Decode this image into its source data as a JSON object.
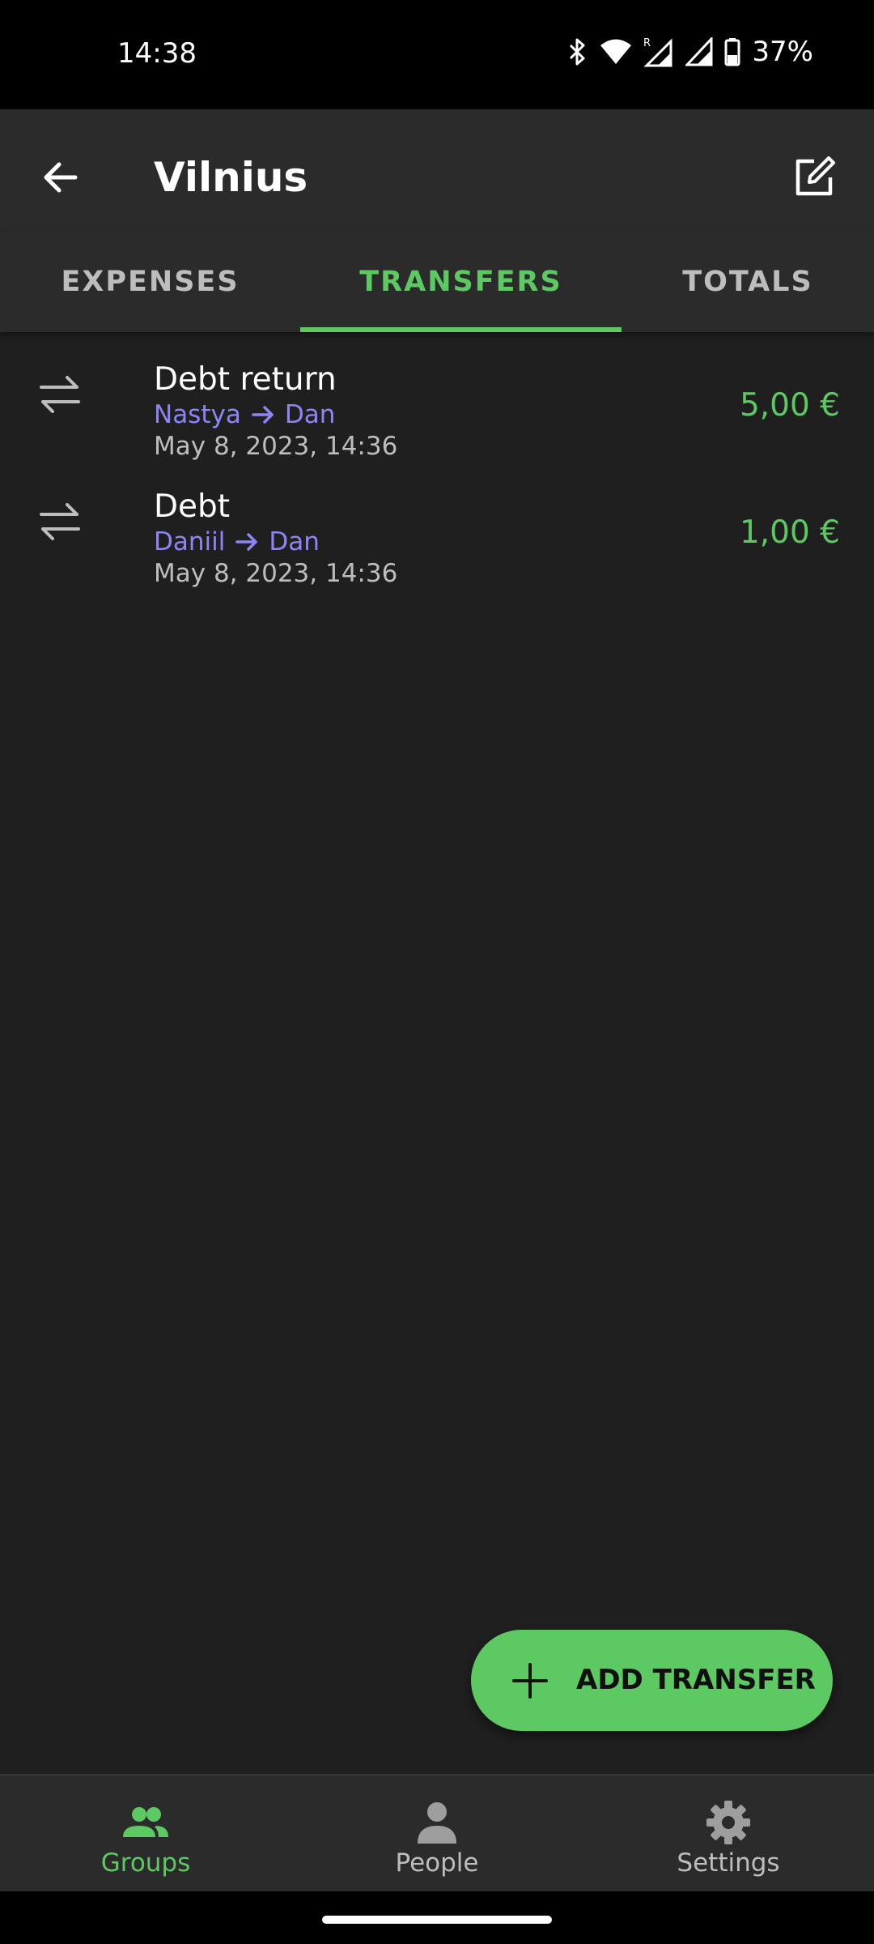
{
  "status_bar": {
    "time": "14:38",
    "battery": "37%",
    "icons": [
      "bluetooth-icon",
      "wifi-icon",
      "signal-roaming-icon",
      "signal-icon",
      "battery-icon"
    ]
  },
  "app_bar": {
    "title": "Vilnius",
    "back_icon": "arrow-back-icon",
    "edit_icon": "edit-icon"
  },
  "tabs": [
    {
      "label": "EXPENSES",
      "active": false
    },
    {
      "label": "TRANSFERS",
      "active": true
    },
    {
      "label": "TOTALS",
      "active": false
    }
  ],
  "transfers": [
    {
      "title": "Debt return",
      "from": "Nastya",
      "to": "Dan",
      "date": "May 8, 2023, 14:36",
      "amount": "5,00 €",
      "icon": "transfer-icon"
    },
    {
      "title": "Debt",
      "from": "Daniil",
      "to": "Dan",
      "date": "May 8, 2023, 14:36",
      "amount": "1,00 €",
      "icon": "transfer-icon"
    }
  ],
  "fab": {
    "label": "ADD TRANSFER",
    "icon": "plus-icon"
  },
  "bottom_nav": [
    {
      "label": "Groups",
      "icon": "groups-icon",
      "active": true
    },
    {
      "label": "People",
      "icon": "person-icon",
      "active": false
    },
    {
      "label": "Settings",
      "icon": "gear-icon",
      "active": false
    }
  ],
  "colors": {
    "accent": "#5cc963",
    "person_link": "#8c86f4",
    "background": "#1f1f1f",
    "surface": "#2b2b2b"
  }
}
